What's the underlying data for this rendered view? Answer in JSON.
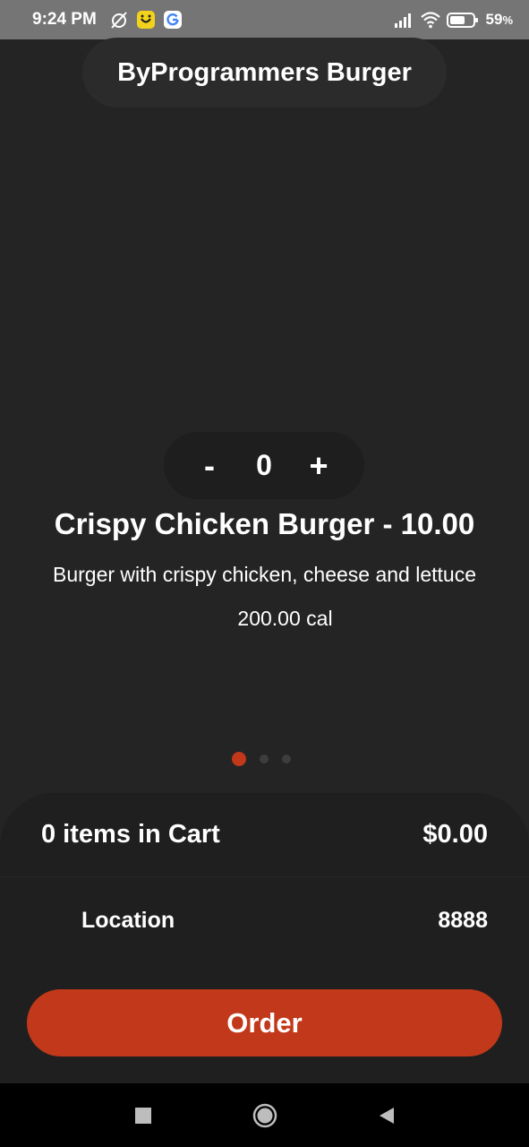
{
  "status_bar": {
    "time": "9:24 PM",
    "battery": "59",
    "battery_unit": "%",
    "icons": [
      "alarm-off-icon",
      "notification-app-icon",
      "google-icon",
      "signal-icon",
      "wifi-icon",
      "battery-icon"
    ]
  },
  "header": {
    "title": "ByProgrammers Burger"
  },
  "product": {
    "quantity": "0",
    "minus_label": "-",
    "plus_label": "+",
    "title": "Crispy Chicken Burger - 10.00",
    "description": "Burger with crispy chicken, cheese and lettuce",
    "calories": "200.00 cal"
  },
  "carousel": {
    "page_count": 3,
    "active_index": 0
  },
  "cart": {
    "count_text": "0 items in Cart",
    "total": "$0.00",
    "location_label": "Location",
    "location_value": "8888"
  },
  "order_button": {
    "label": "Order"
  },
  "nav_bar": {
    "icons": [
      "recent-apps-icon",
      "home-icon",
      "back-icon"
    ]
  },
  "colors": {
    "background": "#242424",
    "accent": "#c2381a",
    "panel": "#1f1f1f",
    "status_bar": "#757575"
  }
}
